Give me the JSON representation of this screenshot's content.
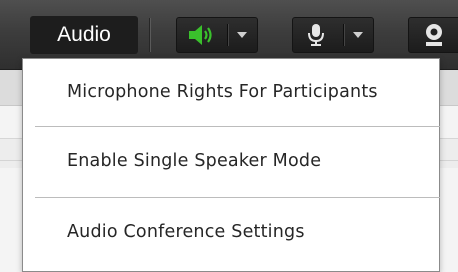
{
  "toolbar": {
    "audio_label": "Audio",
    "speaker_button": {
      "icon": "speaker-icon",
      "state": "on",
      "icon_color": "#3ac12c"
    },
    "microphone_button": {
      "icon": "microphone-icon"
    },
    "camera_button": {
      "icon": "webcam-icon"
    },
    "dropdown_icon": "chevron-down-icon"
  },
  "menu": {
    "items": [
      {
        "label": "Microphone Rights For Participants"
      },
      {
        "label": "Enable Single Speaker Mode"
      },
      {
        "label": "Audio Conference Settings"
      }
    ]
  }
}
